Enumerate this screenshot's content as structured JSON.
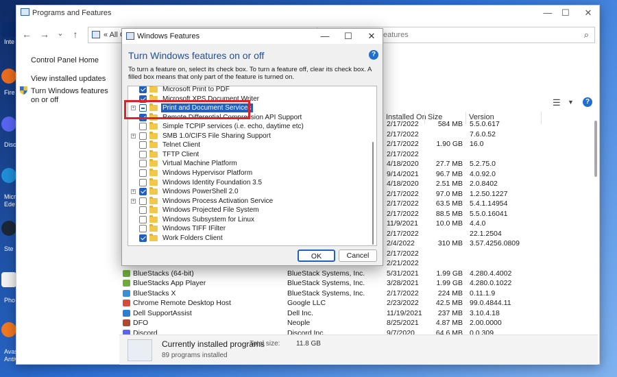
{
  "desktop": {
    "labels": [
      "Inte",
      "Fire",
      "Disc",
      "Micro",
      "Ede",
      "Ste",
      "Pho",
      "Avas",
      "Antiv"
    ]
  },
  "main_window": {
    "title": "Programs and Features",
    "controls": {
      "minimize": "—",
      "maximize": "☐",
      "close": "✕"
    },
    "nav": {
      "back": "←",
      "forward": "→",
      "recent": "⌄",
      "up": "↑"
    },
    "address": "«  All C",
    "search_text": "eatures",
    "left_links": {
      "home": "Control Panel Home",
      "updates": "View installed updates",
      "features": "Turn Windows features on or off"
    },
    "columns": {
      "installed_on": "Installed On",
      "size": "Size",
      "version": "Version"
    },
    "programs": [
      {
        "name": "",
        "publisher": "",
        "date": "2/17/2022",
        "size": "584 MB",
        "version": "5.5.0.617",
        "color": "#ffffff"
      },
      {
        "name": "",
        "publisher": "",
        "date": "2/17/2022",
        "size": "",
        "version": "7.6.0.52",
        "color": "#ffffff"
      },
      {
        "name": "",
        "publisher": "",
        "date": "2/17/2022",
        "size": "1.90 GB",
        "version": "16.0",
        "color": "#ffffff"
      },
      {
        "name": "",
        "publisher": "",
        "date": "2/17/2022",
        "size": "",
        "version": "",
        "color": "#ffffff"
      },
      {
        "name": "",
        "publisher": "",
        "date": "4/18/2020",
        "size": "27.7 MB",
        "version": "5.2.75.0",
        "color": "#ffffff"
      },
      {
        "name": "",
        "publisher": "",
        "date": "9/14/2021",
        "size": "96.7 MB",
        "version": "4.0.92.0",
        "color": "#ffffff"
      },
      {
        "name": "",
        "publisher": "",
        "date": "4/18/2020",
        "size": "2.51 MB",
        "version": "2.0.8402",
        "color": "#ffffff"
      },
      {
        "name": "",
        "publisher": "",
        "date": "2/17/2022",
        "size": "97.0 MB",
        "version": "1.2.50.1227",
        "color": "#ffffff"
      },
      {
        "name": "",
        "publisher": "",
        "date": "2/17/2022",
        "size": "63.5 MB",
        "version": "5.4.1.14954",
        "color": "#ffffff"
      },
      {
        "name": "",
        "publisher": "",
        "date": "2/17/2022",
        "size": "88.5 MB",
        "version": "5.5.0.16041",
        "color": "#ffffff"
      },
      {
        "name": "",
        "publisher": "",
        "date": "11/9/2021",
        "size": "10.0 MB",
        "version": "4.4.0",
        "color": "#ffffff"
      },
      {
        "name": "",
        "publisher": "",
        "date": "2/17/2022",
        "size": "",
        "version": "22.1.2504",
        "color": "#ffffff"
      },
      {
        "name": "",
        "publisher": "",
        "date": "2/4/2022",
        "size": "310 MB",
        "version": "3.57.4256.0809",
        "color": "#ffffff"
      },
      {
        "name": "",
        "publisher": "",
        "date": "2/17/2022",
        "size": "",
        "version": "",
        "color": "#ffffff"
      },
      {
        "name": "",
        "publisher": "",
        "date": "2/21/2022",
        "size": "",
        "version": "",
        "color": "#ffffff"
      },
      {
        "name": "BlueStacks (64-bit)",
        "publisher": "BlueStack Systems, Inc.",
        "date": "5/31/2021",
        "size": "1.99 GB",
        "version": "4.280.4.4002",
        "color": "#6fae3c"
      },
      {
        "name": "BlueStacks App Player",
        "publisher": "BlueStack Systems, Inc.",
        "date": "3/28/2021",
        "size": "1.99 GB",
        "version": "4.280.0.1022",
        "color": "#6fae3c"
      },
      {
        "name": "BlueStacks X",
        "publisher": "BlueStack Systems, Inc.",
        "date": "2/17/2022",
        "size": "224 MB",
        "version": "0.11.1.9",
        "color": "#3c8fd6"
      },
      {
        "name": "Chrome Remote Desktop Host",
        "publisher": "Google LLC",
        "date": "2/23/2022",
        "size": "42.5 MB",
        "version": "99.0.4844.11",
        "color": "#d94a3a"
      },
      {
        "name": "Dell SupportAssist",
        "publisher": "Dell Inc.",
        "date": "11/19/2021",
        "size": "237 MB",
        "version": "3.10.4.18",
        "color": "#2a7fd4"
      },
      {
        "name": "DFO",
        "publisher": "Neople",
        "date": "8/25/2021",
        "size": "4.87 MB",
        "version": "2.00.0000",
        "color": "#b0472e"
      },
      {
        "name": "Discord",
        "publisher": "Discord Inc.",
        "date": "9/7/2020",
        "size": "64.6 MB",
        "version": "0.0.309",
        "color": "#5865f2"
      }
    ],
    "status": {
      "main": "Currently installed programs",
      "total_label": "Total size:",
      "total_value": "11.8 GB",
      "count": "89 programs installed"
    }
  },
  "dialog": {
    "title": "Windows Features",
    "controls": {
      "minimize": "—",
      "maximize": "☐",
      "close": "✕"
    },
    "heading": "Turn Windows features on or off",
    "help": "?",
    "description": "To turn a feature on, select its check box. To turn a feature off, clear its check box. A filled box means that only part of the feature is turned on.",
    "features": [
      {
        "label": "Microsoft Print to PDF",
        "state": "on",
        "expand": false,
        "selected": false
      },
      {
        "label": "Microsoft XPS Document Writer",
        "state": "on",
        "expand": false,
        "selected": false
      },
      {
        "label": "Print and Document Services",
        "state": "partial",
        "expand": true,
        "selected": true
      },
      {
        "label": "Remote Differential Compression API Support",
        "state": "on",
        "expand": false,
        "selected": false
      },
      {
        "label": "Simple TCPIP services (i.e. echo, daytime etc)",
        "state": "off",
        "expand": false,
        "selected": false
      },
      {
        "label": "SMB 1.0/CIFS File Sharing Support",
        "state": "off",
        "expand": true,
        "selected": false
      },
      {
        "label": "Telnet Client",
        "state": "off",
        "expand": false,
        "selected": false
      },
      {
        "label": "TFTP Client",
        "state": "off",
        "expand": false,
        "selected": false
      },
      {
        "label": "Virtual Machine Platform",
        "state": "off",
        "expand": false,
        "selected": false
      },
      {
        "label": "Windows Hypervisor Platform",
        "state": "off",
        "expand": false,
        "selected": false
      },
      {
        "label": "Windows Identity Foundation 3.5",
        "state": "off",
        "expand": false,
        "selected": false
      },
      {
        "label": "Windows PowerShell 2.0",
        "state": "on",
        "expand": true,
        "selected": false
      },
      {
        "label": "Windows Process Activation Service",
        "state": "off",
        "expand": true,
        "selected": false
      },
      {
        "label": "Windows Projected File System",
        "state": "off",
        "expand": false,
        "selected": false
      },
      {
        "label": "Windows Subsystem for Linux",
        "state": "off",
        "expand": false,
        "selected": false
      },
      {
        "label": "Windows TIFF IFilter",
        "state": "off",
        "expand": false,
        "selected": false
      },
      {
        "label": "Work Folders Client",
        "state": "on",
        "expand": false,
        "selected": false
      }
    ],
    "ok_label": "OK",
    "cancel_label": "Cancel"
  },
  "colors": {
    "accent": "#1f5fc0",
    "highlight": "#e0202a",
    "heading": "#1e4e9a"
  }
}
